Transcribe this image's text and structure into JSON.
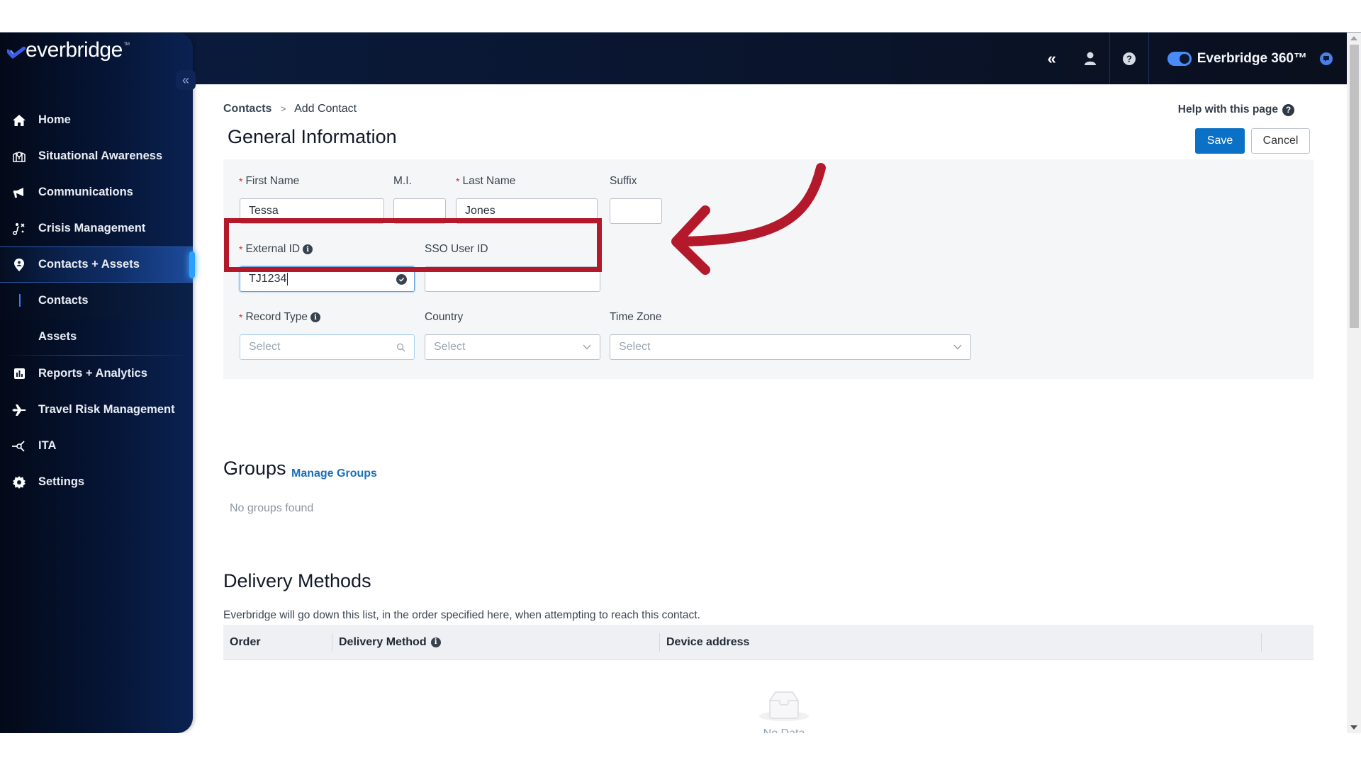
{
  "app": {
    "brand": "everbridge",
    "product_label": "Everbridge 360™",
    "product_toggle_on": true
  },
  "colors": {
    "accent": "#0b71c6",
    "annotation": "#b3192a",
    "sidebar_bg": "#061638",
    "required": "#d0312d"
  },
  "header": {
    "icons": [
      "double-chevron-left-icon",
      "user-icon",
      "help-icon",
      "chat-icon"
    ]
  },
  "sidebar": {
    "collapse_icon": "«",
    "items": [
      {
        "label": "Home",
        "icon": "home-icon"
      },
      {
        "label": "Situational Awareness",
        "icon": "map-pin-icon"
      },
      {
        "label": "Communications",
        "icon": "megaphone-icon"
      },
      {
        "label": "Crisis Management",
        "icon": "crisis-route-icon"
      },
      {
        "label": "Contacts + Assets",
        "icon": "location-person-icon",
        "active": true,
        "children": [
          {
            "label": "Contacts",
            "current": true
          },
          {
            "label": "Assets"
          }
        ]
      },
      {
        "label": "Reports + Analytics",
        "icon": "bar-chart-icon"
      },
      {
        "label": "Travel Risk Management",
        "icon": "plane-icon"
      },
      {
        "label": "ITA",
        "icon": "network-icon"
      },
      {
        "label": "Settings",
        "icon": "gear-icon"
      }
    ]
  },
  "breadcrumb": {
    "parent": "Contacts",
    "separator": ">",
    "current": "Add Contact"
  },
  "page": {
    "title": "General Information",
    "help_label": "Help with this page",
    "save_label": "Save",
    "cancel_label": "Cancel"
  },
  "form": {
    "first_name": {
      "label": "First Name",
      "required": true,
      "value": "Tessa"
    },
    "middle_initial": {
      "label": "M.I.",
      "value": ""
    },
    "last_name": {
      "label": "Last Name",
      "required": true,
      "value": "Jones"
    },
    "suffix": {
      "label": "Suffix",
      "value": ""
    },
    "external_id": {
      "label": "External ID",
      "required": true,
      "value": "TJ1234"
    },
    "sso_user_id": {
      "label": "SSO User ID",
      "value": ""
    },
    "record_type": {
      "label": "Record Type",
      "required": true,
      "placeholder": "Select"
    },
    "country": {
      "label": "Country",
      "placeholder": "Select"
    },
    "time_zone": {
      "label": "Time Zone",
      "placeholder": "Select"
    },
    "required_marker": "*"
  },
  "groups": {
    "title": "Groups",
    "manage_label": "Manage Groups",
    "empty_text": "No groups found"
  },
  "delivery": {
    "title": "Delivery Methods",
    "description": "Everbridge will go down this list, in the order specified here, when attempting to reach this contact.",
    "columns": [
      "Order",
      "Delivery Method",
      "Device address"
    ],
    "empty_text": "No Data"
  }
}
